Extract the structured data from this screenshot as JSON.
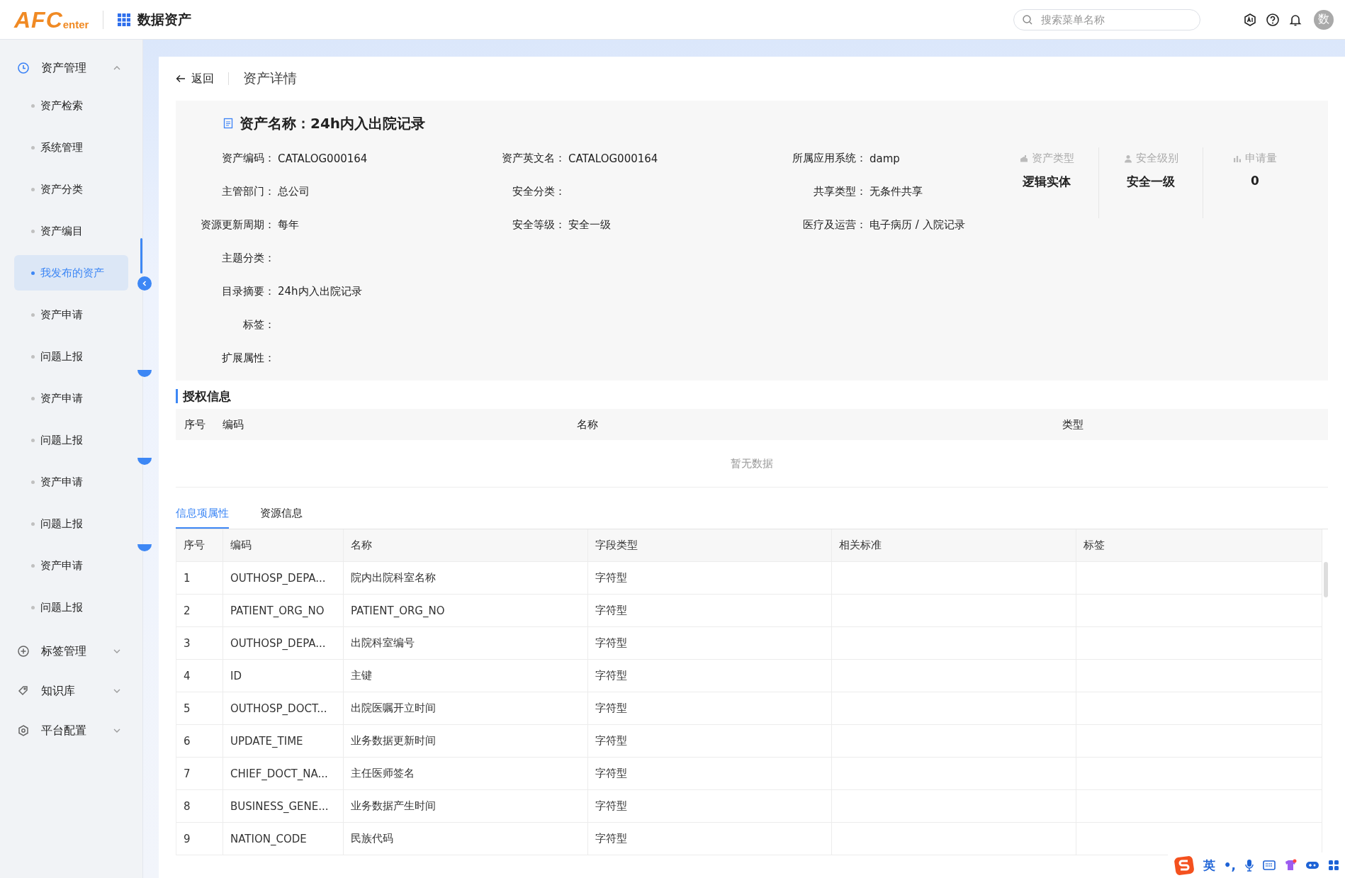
{
  "header": {
    "logo_main": "AFC",
    "logo_sub": "enter",
    "app_title": "数据资产",
    "search": {
      "placeholder": "搜索菜单名称"
    },
    "avatar": "数"
  },
  "sidebar": {
    "items": [
      {
        "label": "资产管理",
        "expanded": true,
        "children": [
          {
            "label": "资产检索",
            "selected": false
          },
          {
            "label": "系统管理",
            "selected": false
          },
          {
            "label": "资产分类",
            "selected": false
          },
          {
            "label": "资产编目",
            "selected": false
          },
          {
            "label": "我发布的资产",
            "selected": true
          },
          {
            "label": "资产申请",
            "selected": false
          },
          {
            "label": "问题上报",
            "selected": false
          },
          {
            "label": "资产申请",
            "selected": false
          },
          {
            "label": "问题上报",
            "selected": false
          },
          {
            "label": "资产申请",
            "selected": false
          },
          {
            "label": "问题上报",
            "selected": false
          },
          {
            "label": "资产申请",
            "selected": false
          },
          {
            "label": "问题上报",
            "selected": false
          }
        ]
      },
      {
        "label": "标签管理",
        "expanded": false
      },
      {
        "label": "知识库",
        "expanded": false
      },
      {
        "label": "平台配置",
        "expanded": false
      }
    ]
  },
  "breadcrumb": {
    "back": "返回",
    "title": "资产详情"
  },
  "asset": {
    "title": "资产名称：24h内入出院记录",
    "rows": [
      [
        {
          "label": "资产编码：",
          "value": "CATALOG000164"
        },
        {
          "label": "资产英文名：",
          "value": "CATALOG000164"
        },
        {
          "label": "所属应用系统：",
          "value": "damp"
        }
      ],
      [
        {
          "label": "主管部门：",
          "value": "总公司"
        },
        {
          "label": "安全分类："
        },
        {
          "label": "共享类型：",
          "value": "无条件共享"
        }
      ],
      [
        {
          "label": "资源更新周期：",
          "value": "每年"
        },
        {
          "label": "安全等级：",
          "value": "安全一级"
        },
        {
          "label": "医疗及运营：",
          "value": "电子病历 / 入院记录"
        }
      ],
      [
        {
          "label": "主题分类："
        }
      ],
      [
        {
          "label": "目录摘要：",
          "value": "24h内入出院记录"
        }
      ],
      [
        {
          "label": "标签："
        }
      ],
      [
        {
          "label": "扩展属性："
        }
      ]
    ],
    "stats": [
      {
        "label": "资产类型",
        "value": "逻辑实体"
      },
      {
        "label": "安全级别",
        "value": "安全一级"
      },
      {
        "label": "申请量",
        "value": "0"
      }
    ]
  },
  "auth": {
    "title": "授权信息",
    "columns": [
      "序号",
      "编码",
      "名称",
      "类型"
    ],
    "empty": "暂无数据"
  },
  "tabs": [
    {
      "label": "信息项属性",
      "selected": true
    },
    {
      "label": "资源信息",
      "selected": false
    }
  ],
  "fields": {
    "columns": [
      "序号",
      "编码",
      "名称",
      "字段类型",
      "相关标准",
      "标签"
    ],
    "rows": [
      [
        "1",
        "OUTHOSP_DEPA...",
        "院内出院科室名称",
        "字符型"
      ],
      [
        "2",
        "PATIENT_ORG_NO",
        "PATIENT_ORG_NO",
        "字符型"
      ],
      [
        "3",
        "OUTHOSP_DEPA...",
        "出院科室编号",
        "字符型"
      ],
      [
        "4",
        "ID",
        "主键",
        "字符型"
      ],
      [
        "5",
        "OUTHOSP_DOCT...",
        "出院医嘱开立时间",
        "字符型"
      ],
      [
        "6",
        "UPDATE_TIME",
        "业务数据更新时间",
        "字符型"
      ],
      [
        "7",
        "CHIEF_DOCT_NA...",
        "主任医师签名",
        "字符型"
      ],
      [
        "8",
        "BUSINESS_GENE...",
        "业务数据产生时间",
        "字符型"
      ],
      [
        "9",
        "NATION_CODE",
        "民族代码",
        "字符型"
      ]
    ]
  },
  "ime": {
    "lang": "英",
    "punct": "•,"
  }
}
